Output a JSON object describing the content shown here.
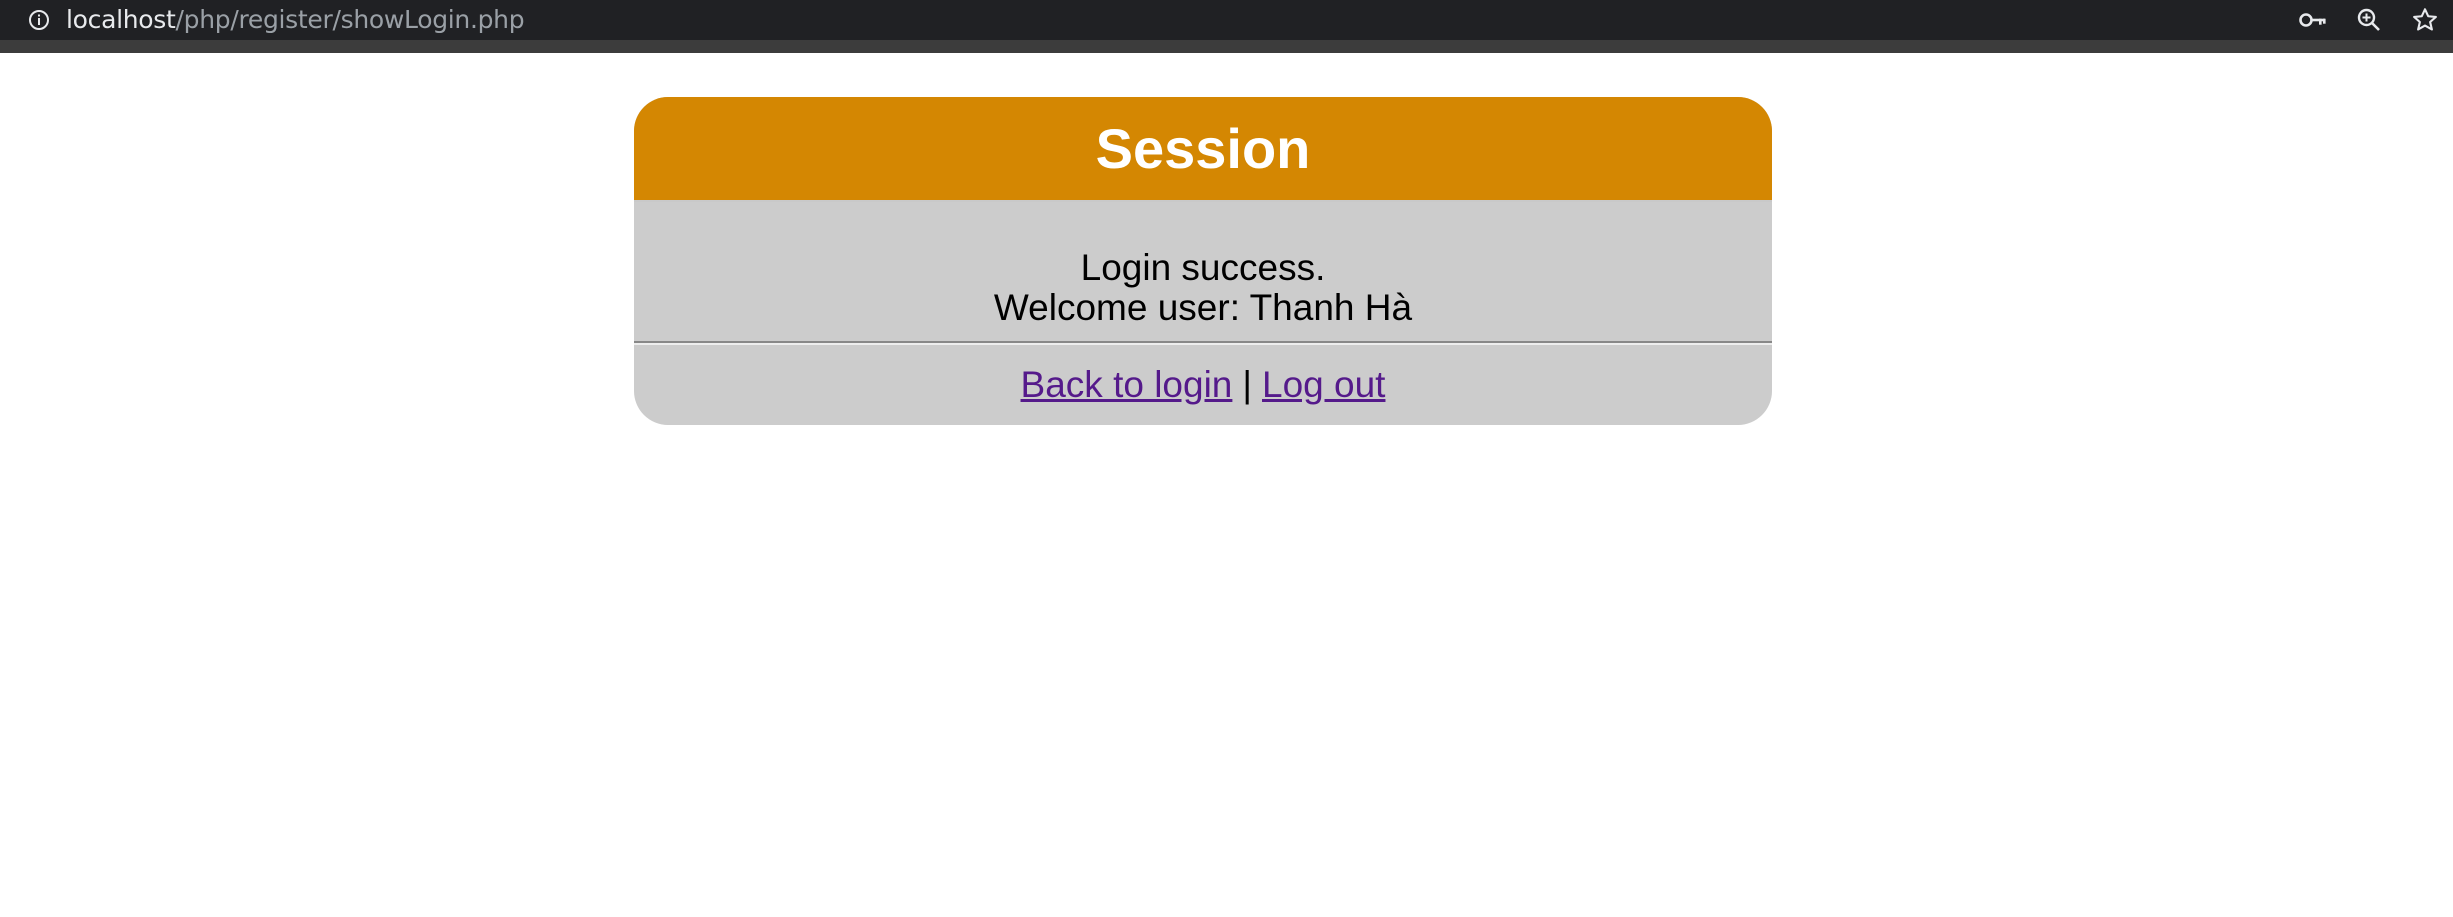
{
  "browser": {
    "url_host": "localhost",
    "url_path": "/php/register/showLogin.php",
    "icons": [
      "info-icon",
      "key-icon",
      "zoom-icon",
      "star-icon"
    ]
  },
  "session": {
    "title": "Session",
    "message_line1": "Login success.",
    "message_line2": "Welcome user: Thanh Hà",
    "back_link": "Back to login",
    "separator": "|",
    "logout_link": "Log out"
  },
  "colors": {
    "header": "#d48702",
    "body": "#cccccc",
    "link": "#551a8b",
    "toolbar": "#202124"
  }
}
